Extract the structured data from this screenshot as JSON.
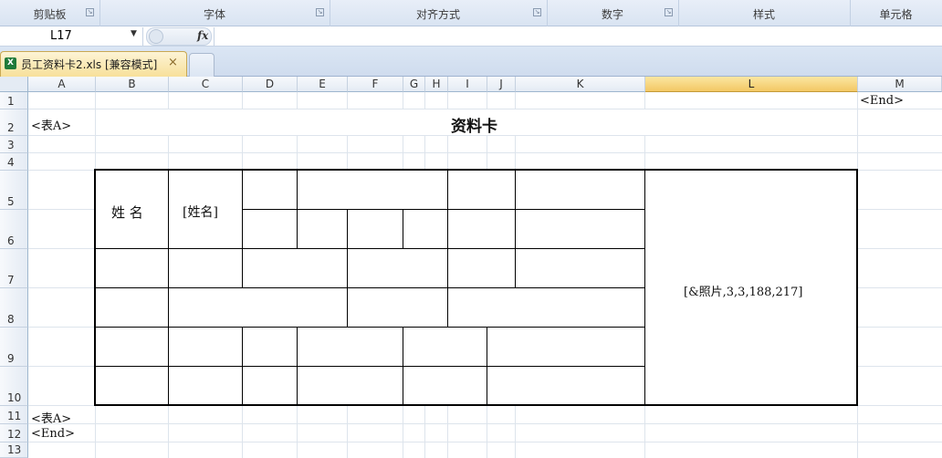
{
  "ribbon": {
    "groups": [
      "剪贴板",
      "字体",
      "对齐方式",
      "数字",
      "样式",
      "单元格"
    ]
  },
  "formula_bar": {
    "name_box": "L17",
    "fx_label": "fx",
    "formula": ""
  },
  "tabs": {
    "active_file": "员工资料卡2.xls  [兼容模式]",
    "close_symbol": "×"
  },
  "grid": {
    "columns": [
      "A",
      "B",
      "C",
      "D",
      "E",
      "F",
      "G",
      "H",
      "I",
      "J",
      "K",
      "L",
      "M"
    ],
    "selected_column": "L",
    "rows": [
      "1",
      "2",
      "3",
      "4",
      "5",
      "6",
      "7",
      "8",
      "9",
      "10",
      "11",
      "12",
      "13"
    ]
  },
  "cells": {
    "m1": "<End>",
    "a2": "<表A>",
    "title": "资料卡",
    "name_label": "姓 名",
    "name_field": "[姓名]",
    "photo_field": "[&照片,3,3,188,217]",
    "a11": "<表A>",
    "a12": "<End>"
  }
}
